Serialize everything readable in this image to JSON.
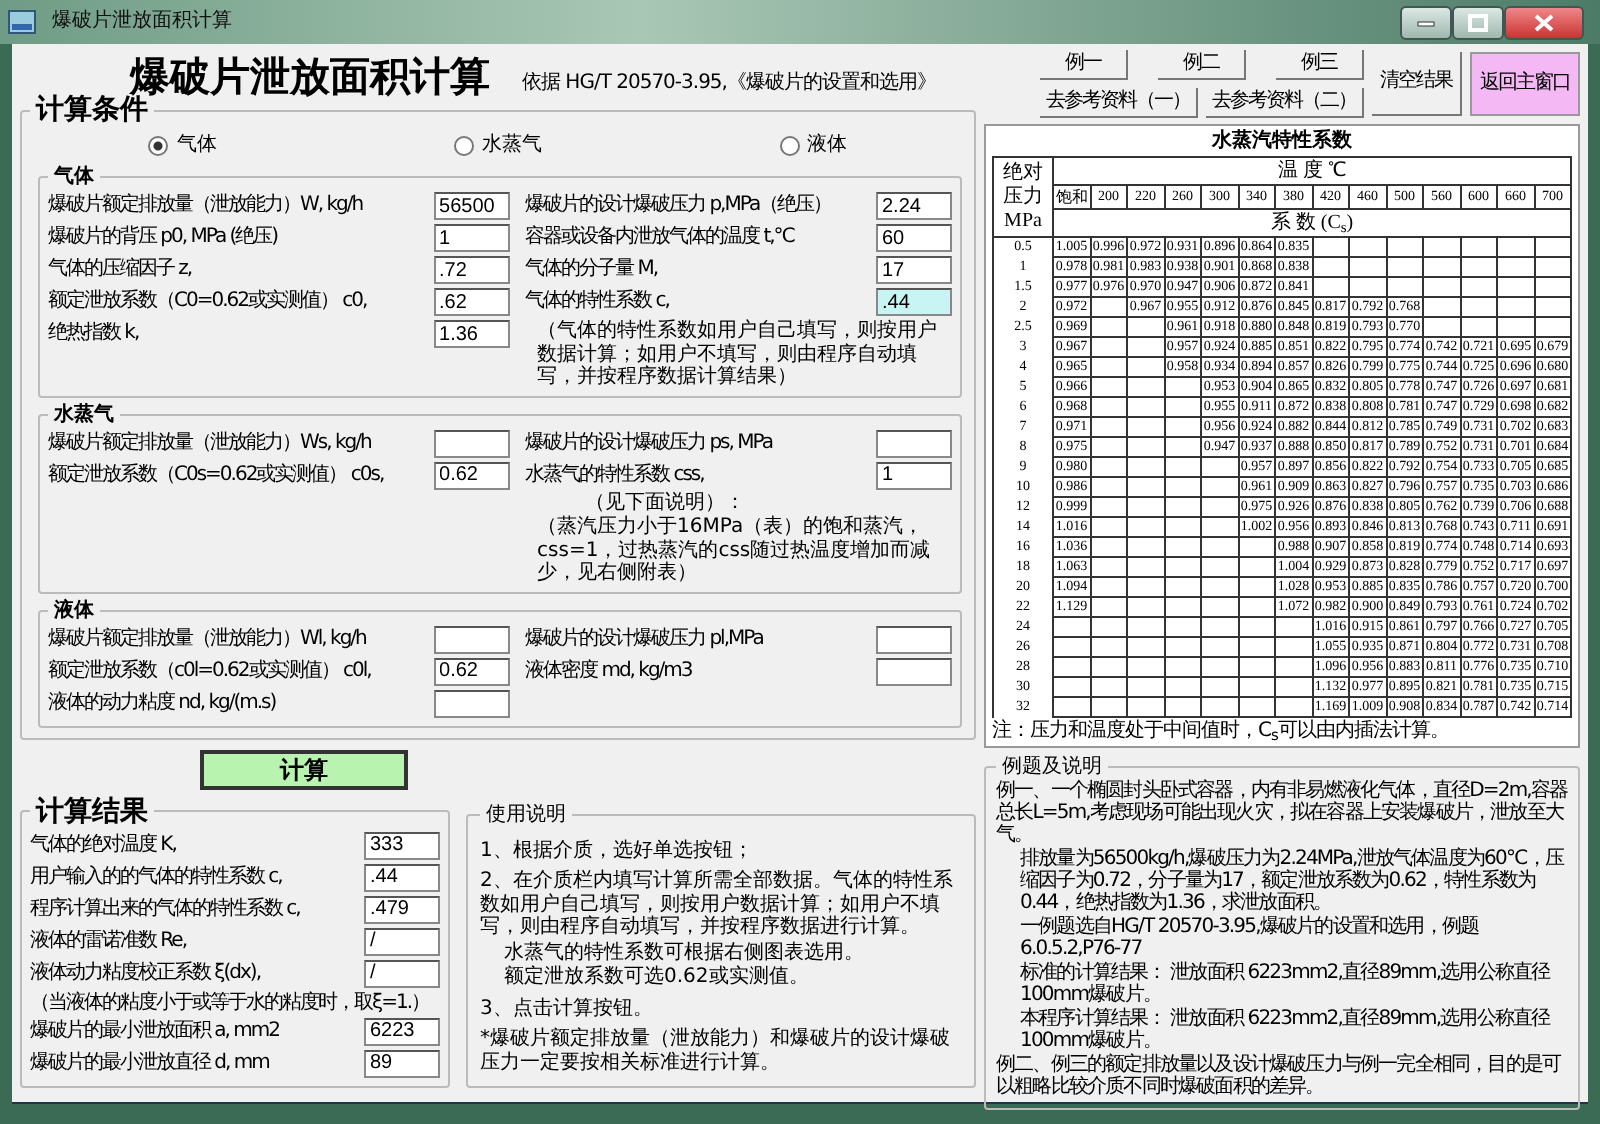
{
  "window": {
    "title": "爆破片泄放面积计算"
  },
  "heading": "爆破片泄放面积计算",
  "reference": "依据 HG/T 20570-3.95,《爆破片的设置和选用》",
  "conditions": {
    "title": "计算条件",
    "media": [
      {
        "label": "气体",
        "selected": true
      },
      {
        "label": "水蒸气",
        "selected": false
      },
      {
        "label": "液体",
        "selected": false
      }
    ],
    "groups": [
      {
        "title": "气体",
        "left": [
          {
            "label": "爆破片额定排放量（泄放能力）W, kg/h",
            "value": "56500",
            "highlighted": false
          },
          {
            "label": "爆破片的背压 p0, MPa (绝压)",
            "value": "1",
            "highlighted": false
          },
          {
            "label": "气体的压缩因子 z,",
            "value": ".72",
            "highlighted": false
          },
          {
            "label": "额定泄放系数（C0=0.62或实测值） c0,",
            "value": ".62",
            "highlighted": false
          },
          {
            "label": "绝热指数 k,",
            "value": "1.36",
            "highlighted": false
          }
        ],
        "right": [
          {
            "label": "爆破片的设计爆破压力 p,MPa（绝压）",
            "value": "2.24",
            "highlighted": false
          },
          {
            "label": "容器或设备内泄放气体的温度 t,℃",
            "value": "60",
            "highlighted": false
          },
          {
            "label": "气体的分子量 M,",
            "value": "17",
            "highlighted": false
          },
          {
            "label": "气体的特性系数 c,",
            "value": ".44",
            "highlighted": true
          }
        ],
        "notes": [
          "（气体的特性系数如用户自己填写，则按用户数据计算；如用户不填写，则由程序自动填写，并按程序数据计算结果）"
        ]
      },
      {
        "title": "水蒸气",
        "left": [
          {
            "label": "爆破片额定排放量（泄放能力）Ws, kg/h"
          },
          {
            "label": "额定泄放系数（C0s=0.62或实测值） c0s,",
            "value": "0.62"
          }
        ],
        "right": [
          {
            "label": "爆破片的设计爆破压力 ps, MPa"
          },
          {
            "label": "水蒸气的特性系数 css,",
            "value": "1"
          }
        ],
        "notes": [
          "（见下面说明）：",
          "（蒸汽压力小于16MPa（表）的饱和蒸汽，css=1，过热蒸汽的css随过热温度增加而减少，见右侧附表）"
        ]
      },
      {
        "title": "液体",
        "left": [
          {
            "label": "爆破片额定排放量（泄放能力）Wl, kg/h"
          },
          {
            "label": "额定泄放系数（c0l=0.62或实测值） c0l,",
            "value": "0.62"
          },
          {
            "label": "液体的动力粘度 nd, kg/(m.s)"
          }
        ],
        "right": [
          {
            "label": "爆破片的设计爆破压力 pl,MPa"
          },
          {
            "label": "液体密度 md, kg/m3"
          }
        ]
      }
    ]
  },
  "calc_button": "计算",
  "results": {
    "title": "计算结果",
    "fields": [
      {
        "label": "气体的绝对温度 K,",
        "value": "333"
      },
      {
        "label": "用户输入的的气体的特性系数 c,",
        "value": ".44"
      },
      {
        "label": "程序计算出来的气体的特性系数 c,",
        "value": ".479"
      },
      {
        "label": "液体的雷诺准数 Re,",
        "value": "/"
      },
      {
        "label": "液体动力粘度校正系数 ξ(dx),",
        "value": "/",
        "note": "（当液体的粘度小于或等于水的粘度时，取ξ=1.）"
      },
      {
        "label": "爆破片的最小泄放面积 a, mm2",
        "value": "6223"
      },
      {
        "label": "爆破片的最小泄放直径 d, mm",
        "value": "89"
      }
    ]
  },
  "instructions": {
    "title": "使用说明",
    "paragraphs": [
      {
        "text": "1、根据介质，选好单选按钮；",
        "indented": false
      },
      {
        "text": "2、在介质栏内填写计算所需全部数据。气体的特性系数如用户自己填写，则按用户数据计算；如用户不填写，则由程序自动填写，并按程序数据进行计算。",
        "indented": false
      },
      {
        "text": "水蒸气的特性系数可根据右侧图表选用。",
        "indented": true
      },
      {
        "text": "额定泄放系数可选0.62或实测值。",
        "indented": true
      },
      {
        "text": "3、点击计算按钮。",
        "indented": false
      },
      {
        "text": "*爆破片额定排放量（泄放能力）和爆破片的设计爆破压力一定要按相关标准进行计算。",
        "indented": false
      }
    ]
  },
  "toolbar": {
    "example_buttons": [
      "例一",
      "例二",
      "例三"
    ],
    "reference_buttons": [
      "去参考资料（一）",
      "去参考资料（二）"
    ],
    "clear_button": "清空结果",
    "return_button": "返回主窗口"
  },
  "steam_table": {
    "title": "水蒸汽特性系数",
    "pressure_header": "绝对压力 MPa",
    "temperature_header": "温 度 ℃",
    "coefficient_header": "系 数 (C$_{s}$)",
    "temperatures": [
      "饱和",
      "200",
      "220",
      "260",
      "300",
      "340",
      "380",
      "420",
      "460",
      "500",
      "560",
      "600",
      "660",
      "700"
    ],
    "rows": [
      {
        "pressure": "0.5",
        "cells": [
          {
            "kind": "value",
            "text": "1.005"
          },
          {
            "kind": "value",
            "text": "0.996"
          },
          {
            "kind": "value",
            "text": "0.972"
          },
          {
            "kind": "value",
            "text": "0.931"
          },
          {
            "kind": "value",
            "text": "0.896"
          },
          {
            "kind": "value",
            "text": "0.864"
          },
          {
            "kind": "value",
            "text": "0.835"
          },
          {
            "kind": "blank"
          },
          {
            "kind": "blank"
          },
          {
            "kind": "blank"
          },
          {
            "kind": "blank"
          },
          {
            "kind": "blank"
          },
          {
            "kind": "blank"
          },
          {
            "kind": "blank"
          }
        ]
      },
      {
        "pressure": "1",
        "cells": [
          {
            "kind": "value",
            "text": "0.978"
          },
          {
            "kind": "value",
            "text": "0.981"
          },
          {
            "kind": "value",
            "text": "0.983"
          },
          {
            "kind": "value",
            "text": "0.938"
          },
          {
            "kind": "value",
            "text": "0.901"
          },
          {
            "kind": "value",
            "text": "0.868"
          },
          {
            "kind": "value",
            "text": "0.838"
          },
          {
            "kind": "blank"
          },
          {
            "kind": "blank"
          },
          {
            "kind": "blank"
          },
          {
            "kind": "blank"
          },
          {
            "kind": "blank"
          },
          {
            "kind": "blank"
          },
          {
            "kind": "blank"
          }
        ]
      },
      {
        "pressure": "1.5",
        "cells": [
          {
            "kind": "value",
            "text": "0.977"
          },
          {
            "kind": "value",
            "text": "0.976"
          },
          {
            "kind": "value",
            "text": "0.970"
          },
          {
            "kind": "value",
            "text": "0.947"
          },
          {
            "kind": "value",
            "text": "0.906"
          },
          {
            "kind": "value",
            "text": "0.872"
          },
          {
            "kind": "value",
            "text": "0.841"
          },
          {
            "kind": "blank"
          },
          {
            "kind": "blank"
          },
          {
            "kind": "blank"
          },
          {
            "kind": "blank"
          },
          {
            "kind": "blank"
          },
          {
            "kind": "blank"
          },
          {
            "kind": "blank"
          }
        ]
      },
      {
        "pressure": "2",
        "cells": [
          {
            "kind": "value",
            "text": "0.972"
          },
          {
            "kind": "blank"
          },
          {
            "kind": "value",
            "text": "0.967"
          },
          {
            "kind": "value",
            "text": "0.955"
          },
          {
            "kind": "value",
            "text": "0.912"
          },
          {
            "kind": "value",
            "text": "0.876"
          },
          {
            "kind": "value",
            "text": "0.845"
          },
          {
            "kind": "value",
            "text": "0.817"
          },
          {
            "kind": "value",
            "text": "0.792"
          },
          {
            "kind": "value",
            "text": "0.768"
          },
          {
            "kind": "blank"
          },
          {
            "kind": "blank"
          },
          {
            "kind": "blank"
          },
          {
            "kind": "blank"
          }
        ]
      },
      {
        "pressure": "2.5",
        "cells": [
          {
            "kind": "value",
            "text": "0.969"
          },
          {
            "kind": "blank"
          },
          {
            "kind": "blank"
          },
          {
            "kind": "value",
            "text": "0.961"
          },
          {
            "kind": "value",
            "text": "0.918"
          },
          {
            "kind": "value",
            "text": "0.880"
          },
          {
            "kind": "value",
            "text": "0.848"
          },
          {
            "kind": "value",
            "text": "0.819"
          },
          {
            "kind": "value",
            "text": "0.793"
          },
          {
            "kind": "value",
            "text": "0.770"
          },
          {
            "kind": "blank"
          },
          {
            "kind": "blank"
          },
          {
            "kind": "blank"
          },
          {
            "kind": "blank"
          }
        ]
      },
      {
        "pressure": "3",
        "cells": [
          {
            "kind": "value",
            "text": "0.967"
          },
          {
            "kind": "blank"
          },
          {
            "kind": "blank"
          },
          {
            "kind": "value",
            "text": "0.957"
          },
          {
            "kind": "value",
            "text": "0.924"
          },
          {
            "kind": "value",
            "text": "0.885"
          },
          {
            "kind": "value",
            "text": "0.851"
          },
          {
            "kind": "value",
            "text": "0.822"
          },
          {
            "kind": "value",
            "text": "0.795"
          },
          {
            "kind": "value",
            "text": "0.774"
          },
          {
            "kind": "value",
            "text": "0.742"
          },
          {
            "kind": "value",
            "text": "0.721"
          },
          {
            "kind": "value",
            "text": "0.695"
          },
          {
            "kind": "value",
            "text": "0.679"
          }
        ]
      },
      {
        "pressure": "4",
        "cells": [
          {
            "kind": "value",
            "text": "0.965"
          },
          {
            "kind": "blank"
          },
          {
            "kind": "blank"
          },
          {
            "kind": "value",
            "text": "0.958"
          },
          {
            "kind": "value",
            "text": "0.934"
          },
          {
            "kind": "value",
            "text": "0.894"
          },
          {
            "kind": "value",
            "text": "0.857"
          },
          {
            "kind": "value",
            "text": "0.826"
          },
          {
            "kind": "value",
            "text": "0.799"
          },
          {
            "kind": "value",
            "text": "0.775"
          },
          {
            "kind": "value",
            "text": "0.744"
          },
          {
            "kind": "value",
            "text": "0.725"
          },
          {
            "kind": "value",
            "text": "0.696"
          },
          {
            "kind": "value",
            "text": "0.680"
          }
        ]
      },
      {
        "pressure": "5",
        "cells": [
          {
            "kind": "value",
            "text": "0.966"
          },
          {
            "kind": "blank"
          },
          {
            "kind": "blank"
          },
          {
            "kind": "blank"
          },
          {
            "kind": "value",
            "text": "0.953"
          },
          {
            "kind": "value",
            "text": "0.904"
          },
          {
            "kind": "value",
            "text": "0.865"
          },
          {
            "kind": "value",
            "text": "0.832"
          },
          {
            "kind": "value",
            "text": "0.805"
          },
          {
            "kind": "value",
            "text": "0.778"
          },
          {
            "kind": "value",
            "text": "0.747"
          },
          {
            "kind": "value",
            "text": "0.726"
          },
          {
            "kind": "value",
            "text": "0.697"
          },
          {
            "kind": "value",
            "text": "0.681"
          }
        ]
      },
      {
        "pressure": "6",
        "cells": [
          {
            "kind": "value",
            "text": "0.968"
          },
          {
            "kind": "blank"
          },
          {
            "kind": "blank"
          },
          {
            "kind": "blank"
          },
          {
            "kind": "value",
            "text": "0.955"
          },
          {
            "kind": "value",
            "text": "0.911"
          },
          {
            "kind": "value",
            "text": "0.872"
          },
          {
            "kind": "value",
            "text": "0.838"
          },
          {
            "kind": "value",
            "text": "0.808"
          },
          {
            "kind": "value",
            "text": "0.781"
          },
          {
            "kind": "value",
            "text": "0.747"
          },
          {
            "kind": "value",
            "text": "0.729"
          },
          {
            "kind": "value",
            "text": "0.698"
          },
          {
            "kind": "value",
            "text": "0.682"
          }
        ]
      },
      {
        "pressure": "7",
        "cells": [
          {
            "kind": "value",
            "text": "0.971"
          },
          {
            "kind": "blank"
          },
          {
            "kind": "blank"
          },
          {
            "kind": "blank"
          },
          {
            "kind": "value",
            "text": "0.956"
          },
          {
            "kind": "value",
            "text": "0.924"
          },
          {
            "kind": "value",
            "text": "0.882"
          },
          {
            "kind": "value",
            "text": "0.844"
          },
          {
            "kind": "value",
            "text": "0.812"
          },
          {
            "kind": "value",
            "text": "0.785"
          },
          {
            "kind": "value",
            "text": "0.749"
          },
          {
            "kind": "value",
            "text": "0.731"
          },
          {
            "kind": "value",
            "text": "0.702"
          },
          {
            "kind": "value",
            "text": "0.683"
          }
        ]
      },
      {
        "pressure": "8",
        "cells": [
          {
            "kind": "value",
            "text": "0.975"
          },
          {
            "kind": "blank"
          },
          {
            "kind": "blank"
          },
          {
            "kind": "blank"
          },
          {
            "kind": "value",
            "text": "0.947"
          },
          {
            "kind": "value",
            "text": "0.937"
          },
          {
            "kind": "value",
            "text": "0.888"
          },
          {
            "kind": "value",
            "text": "0.850"
          },
          {
            "kind": "value",
            "text": "0.817"
          },
          {
            "kind": "value",
            "text": "0.789"
          },
          {
            "kind": "value",
            "text": "0.752"
          },
          {
            "kind": "value",
            "text": "0.731"
          },
          {
            "kind": "value",
            "text": "0.701"
          },
          {
            "kind": "value",
            "text": "0.684"
          }
        ]
      },
      {
        "pressure": "9",
        "cells": [
          {
            "kind": "value",
            "text": "0.980"
          },
          {
            "kind": "blank"
          },
          {
            "kind": "blank"
          },
          {
            "kind": "blank"
          },
          {
            "kind": "blank"
          },
          {
            "kind": "value",
            "text": "0.957"
          },
          {
            "kind": "value",
            "text": "0.897"
          },
          {
            "kind": "value",
            "text": "0.856"
          },
          {
            "kind": "value",
            "text": "0.822"
          },
          {
            "kind": "value",
            "text": "0.792"
          },
          {
            "kind": "value",
            "text": "0.754"
          },
          {
            "kind": "value",
            "text": "0.733"
          },
          {
            "kind": "value",
            "text": "0.705"
          },
          {
            "kind": "value",
            "text": "0.685"
          }
        ]
      },
      {
        "pressure": "10",
        "cells": [
          {
            "kind": "value",
            "text": "0.986"
          },
          {
            "kind": "blank"
          },
          {
            "kind": "blank"
          },
          {
            "kind": "blank"
          },
          {
            "kind": "blank"
          },
          {
            "kind": "value",
            "text": "0.961"
          },
          {
            "kind": "value",
            "text": "0.909"
          },
          {
            "kind": "value",
            "text": "0.863"
          },
          {
            "kind": "value",
            "text": "0.827"
          },
          {
            "kind": "value",
            "text": "0.796"
          },
          {
            "kind": "value",
            "text": "0.757"
          },
          {
            "kind": "value",
            "text": "0.735"
          },
          {
            "kind": "value",
            "text": "0.703"
          },
          {
            "kind": "value",
            "text": "0.686"
          }
        ]
      },
      {
        "pressure": "12",
        "cells": [
          {
            "kind": "value",
            "text": "0.999"
          },
          {
            "kind": "blank"
          },
          {
            "kind": "blank"
          },
          {
            "kind": "blank"
          },
          {
            "kind": "blank"
          },
          {
            "kind": "value",
            "text": "0.975"
          },
          {
            "kind": "value",
            "text": "0.926"
          },
          {
            "kind": "value",
            "text": "0.876"
          },
          {
            "kind": "value",
            "text": "0.838"
          },
          {
            "kind": "value",
            "text": "0.805"
          },
          {
            "kind": "value",
            "text": "0.762"
          },
          {
            "kind": "value",
            "text": "0.739"
          },
          {
            "kind": "value",
            "text": "0.706"
          },
          {
            "kind": "value",
            "text": "0.688"
          }
        ]
      },
      {
        "pressure": "14",
        "cells": [
          {
            "kind": "value",
            "text": "1.016"
          },
          {
            "kind": "blank"
          },
          {
            "kind": "blank"
          },
          {
            "kind": "blank"
          },
          {
            "kind": "blank"
          },
          {
            "kind": "value",
            "text": "1.002"
          },
          {
            "kind": "value",
            "text": "0.956"
          },
          {
            "kind": "value",
            "text": "0.893"
          },
          {
            "kind": "value",
            "text": "0.846"
          },
          {
            "kind": "value",
            "text": "0.813"
          },
          {
            "kind": "value",
            "text": "0.768"
          },
          {
            "kind": "value",
            "text": "0.743"
          },
          {
            "kind": "value",
            "text": "0.711"
          },
          {
            "kind": "value",
            "text": "0.691"
          }
        ]
      },
      {
        "pressure": "16",
        "cells": [
          {
            "kind": "value",
            "text": "1.036"
          },
          {
            "kind": "blank"
          },
          {
            "kind": "blank"
          },
          {
            "kind": "blank"
          },
          {
            "kind": "blank"
          },
          {
            "kind": "blank"
          },
          {
            "kind": "value",
            "text": "0.988"
          },
          {
            "kind": "value",
            "text": "0.907"
          },
          {
            "kind": "value",
            "text": "0.858"
          },
          {
            "kind": "value",
            "text": "0.819"
          },
          {
            "kind": "value",
            "text": "0.774"
          },
          {
            "kind": "value",
            "text": "0.748"
          },
          {
            "kind": "value",
            "text": "0.714"
          },
          {
            "kind": "value",
            "text": "0.693"
          }
        ]
      },
      {
        "pressure": "18",
        "cells": [
          {
            "kind": "value",
            "text": "1.063"
          },
          {
            "kind": "blank"
          },
          {
            "kind": "blank"
          },
          {
            "kind": "blank"
          },
          {
            "kind": "blank"
          },
          {
            "kind": "blank"
          },
          {
            "kind": "value",
            "text": "1.004"
          },
          {
            "kind": "value",
            "text": "0.929"
          },
          {
            "kind": "value",
            "text": "0.873"
          },
          {
            "kind": "value",
            "text": "0.828"
          },
          {
            "kind": "value",
            "text": "0.779"
          },
          {
            "kind": "value",
            "text": "0.752"
          },
          {
            "kind": "value",
            "text": "0.717"
          },
          {
            "kind": "value",
            "text": "0.697"
          }
        ]
      },
      {
        "pressure": "20",
        "cells": [
          {
            "kind": "value",
            "text": "1.094"
          },
          {
            "kind": "blank"
          },
          {
            "kind": "blank"
          },
          {
            "kind": "blank"
          },
          {
            "kind": "blank"
          },
          {
            "kind": "blank"
          },
          {
            "kind": "value",
            "text": "1.028"
          },
          {
            "kind": "value",
            "text": "0.953"
          },
          {
            "kind": "value",
            "text": "0.885"
          },
          {
            "kind": "value",
            "text": "0.835"
          },
          {
            "kind": "value",
            "text": "0.786"
          },
          {
            "kind": "value",
            "text": "0.757"
          },
          {
            "kind": "value",
            "text": "0.720"
          },
          {
            "kind": "value",
            "text": "0.700"
          }
        ]
      },
      {
        "pressure": "22",
        "cells": [
          {
            "kind": "value",
            "text": "1.129"
          },
          {
            "kind": "blank"
          },
          {
            "kind": "blank"
          },
          {
            "kind": "blank"
          },
          {
            "kind": "blank"
          },
          {
            "kind": "blank"
          },
          {
            "kind": "value",
            "text": "1.072"
          },
          {
            "kind": "value",
            "text": "0.982"
          },
          {
            "kind": "value",
            "text": "0.900"
          },
          {
            "kind": "value",
            "text": "0.849"
          },
          {
            "kind": "value",
            "text": "0.793"
          },
          {
            "kind": "value",
            "text": "0.761"
          },
          {
            "kind": "value",
            "text": "0.724"
          },
          {
            "kind": "value",
            "text": "0.702"
          }
        ]
      },
      {
        "pressure": "24",
        "cells": [
          {
            "kind": "blank"
          },
          {
            "kind": "blank"
          },
          {
            "kind": "blank"
          },
          {
            "kind": "blank"
          },
          {
            "kind": "blank"
          },
          {
            "kind": "blank"
          },
          {
            "kind": "blank"
          },
          {
            "kind": "value",
            "text": "1.016"
          },
          {
            "kind": "value",
            "text": "0.915"
          },
          {
            "kind": "value",
            "text": "0.861"
          },
          {
            "kind": "value",
            "text": "0.797"
          },
          {
            "kind": "value",
            "text": "0.766"
          },
          {
            "kind": "value",
            "text": "0.727"
          },
          {
            "kind": "value",
            "text": "0.705"
          }
        ]
      },
      {
        "pressure": "26",
        "cells": [
          {
            "kind": "blank"
          },
          {
            "kind": "blank"
          },
          {
            "kind": "blank"
          },
          {
            "kind": "blank"
          },
          {
            "kind": "blank"
          },
          {
            "kind": "blank"
          },
          {
            "kind": "blank"
          },
          {
            "kind": "value",
            "text": "1.055"
          },
          {
            "kind": "value",
            "text": "0.935"
          },
          {
            "kind": "value",
            "text": "0.871"
          },
          {
            "kind": "value",
            "text": "0.804"
          },
          {
            "kind": "value",
            "text": "0.772"
          },
          {
            "kind": "value",
            "text": "0.731"
          },
          {
            "kind": "value",
            "text": "0.708"
          }
        ]
      },
      {
        "pressure": "28",
        "cells": [
          {
            "kind": "blank"
          },
          {
            "kind": "blank"
          },
          {
            "kind": "blank"
          },
          {
            "kind": "blank"
          },
          {
            "kind": "blank"
          },
          {
            "kind": "blank"
          },
          {
            "kind": "blank"
          },
          {
            "kind": "value",
            "text": "1.096"
          },
          {
            "kind": "value",
            "text": "0.956"
          },
          {
            "kind": "value",
            "text": "0.883"
          },
          {
            "kind": "value",
            "text": "0.811"
          },
          {
            "kind": "value",
            "text": "0.776"
          },
          {
            "kind": "value",
            "text": "0.735"
          },
          {
            "kind": "value",
            "text": "0.710"
          }
        ]
      },
      {
        "pressure": "30",
        "cells": [
          {
            "kind": "blank"
          },
          {
            "kind": "blank"
          },
          {
            "kind": "blank"
          },
          {
            "kind": "blank"
          },
          {
            "kind": "blank"
          },
          {
            "kind": "blank"
          },
          {
            "kind": "blank"
          },
          {
            "kind": "value",
            "text": "1.132"
          },
          {
            "kind": "value",
            "text": "0.977"
          },
          {
            "kind": "value",
            "text": "0.895"
          },
          {
            "kind": "value",
            "text": "0.821"
          },
          {
            "kind": "value",
            "text": "0.781"
          },
          {
            "kind": "value",
            "text": "0.735"
          },
          {
            "kind": "value",
            "text": "0.715"
          }
        ]
      },
      {
        "pressure": "32",
        "cells": [
          {
            "kind": "blank"
          },
          {
            "kind": "blank"
          },
          {
            "kind": "blank"
          },
          {
            "kind": "blank"
          },
          {
            "kind": "blank"
          },
          {
            "kind": "blank"
          },
          {
            "kind": "blank"
          },
          {
            "kind": "value",
            "text": "1.169"
          },
          {
            "kind": "value",
            "text": "1.009"
          },
          {
            "kind": "value",
            "text": "0.908"
          },
          {
            "kind": "value",
            "text": "0.834"
          },
          {
            "kind": "value",
            "text": "0.787"
          },
          {
            "kind": "value",
            "text": "0.742"
          },
          {
            "kind": "value",
            "text": "0.714"
          }
        ]
      }
    ],
    "footnote": "注：压力和温度处于中间值时，C$_{s}$可以由内插法计算。"
  },
  "example": {
    "title": "例题及说明",
    "paragraphs": [
      {
        "text": "例一、一个椭圆封头卧式容器，内有非易燃液化气体，直径D=2m,容器总长L=5m,考虑现场可能出现火灾，拟在容器上安装爆破片，泄放至大气。",
        "indented": false
      },
      {
        "text": "排放量为56500kg/h,爆破压力为2.24MPa,泄放气体温度为60℃，压缩因子为0.72，分子量为17，额定泄放系数为0.62，特性系数为0.44，绝热指数为1.36，求泄放面积。",
        "indented": true
      },
      {
        "text": "一例题选自HG/T 20570-3.95,爆破片的设置和选用，例题6.0.5.2,P76-77",
        "indented": true
      },
      {
        "text": "标准的计算结果： 泄放面积 6223mm2,直径89mm,选用公称直径100mm爆破片。",
        "indented": true
      },
      {
        "text": "本程序计算结果： 泄放面积 6223mm2,直径89mm,选用公称直径100mm爆破片。",
        "indented": true
      },
      {
        "text": "例二、例三的额定排放量以及设计爆破压力与例一完全相同，目的是可以粗略比较介质不同时爆破面积的差异。",
        "indented": false
      }
    ]
  }
}
